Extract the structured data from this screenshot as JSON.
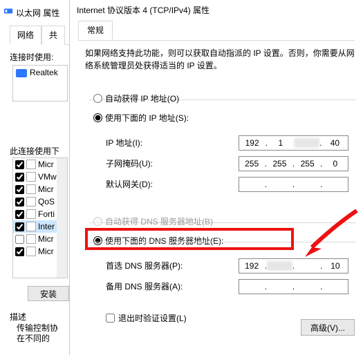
{
  "back": {
    "title": "以太网 属性",
    "tabs": {
      "net": "网络",
      "share": "共"
    },
    "sec_connect": "连接时使用:",
    "adapter": "Realtek",
    "sec_items": "此连接使用下",
    "items": [
      {
        "label": "Micr",
        "checked": true
      },
      {
        "label": "VMw",
        "checked": true
      },
      {
        "label": "Micr",
        "checked": true
      },
      {
        "label": "QoS",
        "checked": true
      },
      {
        "label": "Forti",
        "checked": true
      },
      {
        "label": "Inter",
        "checked": true,
        "selected": true
      },
      {
        "label": "Micr",
        "checked": false
      },
      {
        "label": "Micr",
        "checked": true
      }
    ],
    "install_btn": "安装",
    "sec_desc": "描述",
    "desc_text": "传输控制协\n在不同的"
  },
  "dlg": {
    "title": "Internet 协议版本 4 (TCP/IPv4) 属性",
    "tab": "常规",
    "intro": "如果网络支持此功能，则可以获取自动指派的 IP 设置。否则，你需要从网络系统管理员处获得适当的 IP 设置。",
    "radio_auto_ip": "自动获得 IP 地址(O)",
    "radio_use_ip": "使用下面的 IP 地址(S):",
    "lbl_ip": "IP 地址(I):",
    "lbl_mask": "子网掩码(U):",
    "lbl_gw": "默认网关(D):",
    "radio_auto_dns": "自动获得 DNS 服务器地址(B)",
    "radio_use_dns": "使用下面的 DNS 服务器地址(E):",
    "lbl_dns1": "首选 DNS 服务器(P):",
    "lbl_dns2": "备用 DNS 服务器(A):",
    "ip": {
      "a": "192",
      "b": "1",
      "c": "",
      "d": "40"
    },
    "mask": {
      "a": "255",
      "b": "255",
      "c": "255",
      "d": "0"
    },
    "dns1": {
      "a": "192",
      "b": "",
      "c": "",
      "d": "10"
    },
    "chk_validate": "退出时验证设置(L)",
    "btn_adv": "高级(V)..."
  }
}
